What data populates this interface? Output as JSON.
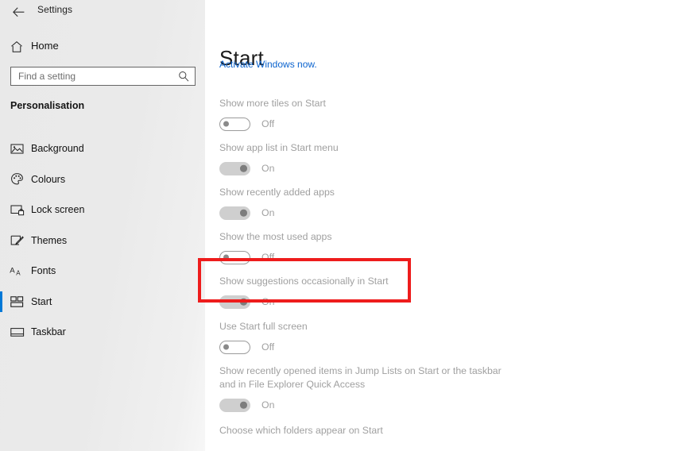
{
  "titlebar": {
    "back_label": "←",
    "back_icon": "back-arrow-icon",
    "title": "Settings"
  },
  "sidebar": {
    "home": {
      "label": "Home",
      "icon": "home-icon"
    },
    "search": {
      "placeholder": "Find a setting",
      "value": "",
      "icon": "search-icon"
    },
    "section_heading": "Personalisation",
    "items": [
      {
        "label": "Background",
        "icon": "picture-icon",
        "selected": false
      },
      {
        "label": "Colours",
        "icon": "palette-icon",
        "selected": false
      },
      {
        "label": "Lock screen",
        "icon": "lock-screen-icon",
        "selected": false
      },
      {
        "label": "Themes",
        "icon": "themes-icon",
        "selected": false
      },
      {
        "label": "Fonts",
        "icon": "fonts-icon",
        "selected": false
      },
      {
        "label": "Start",
        "icon": "start-tiles-icon",
        "selected": true
      },
      {
        "label": "Taskbar",
        "icon": "taskbar-icon",
        "selected": false
      }
    ]
  },
  "main": {
    "page_title": "Start",
    "activate_link": "Activate Windows now.",
    "settings": [
      {
        "label": "Show more tiles on Start",
        "state": "Off",
        "on": false
      },
      {
        "label": "Show app list in Start menu",
        "state": "On",
        "on": true
      },
      {
        "label": "Show recently added apps",
        "state": "On",
        "on": true
      },
      {
        "label": "Show the most used apps",
        "state": "Off",
        "on": false
      },
      {
        "label": "Show suggestions occasionally in Start",
        "state": "On",
        "on": true
      },
      {
        "label": "Use Start full screen",
        "state": "Off",
        "on": false
      },
      {
        "label": "Show recently opened items in Jump Lists on Start or the taskbar and in File Explorer Quick Access",
        "state": "On",
        "on": true
      }
    ],
    "folders_link": "Choose which folders appear on Start"
  },
  "annotation": {
    "highlight_target": "Show suggestions occasionally in Start",
    "color": "#ee1c1c"
  },
  "colors": {
    "accent": "#0078d7",
    "link": "#0b63ce",
    "sidebar_bg": "#eaeaea",
    "label_grey": "#a0a0a0",
    "highlight_red": "#ee1c1c"
  }
}
